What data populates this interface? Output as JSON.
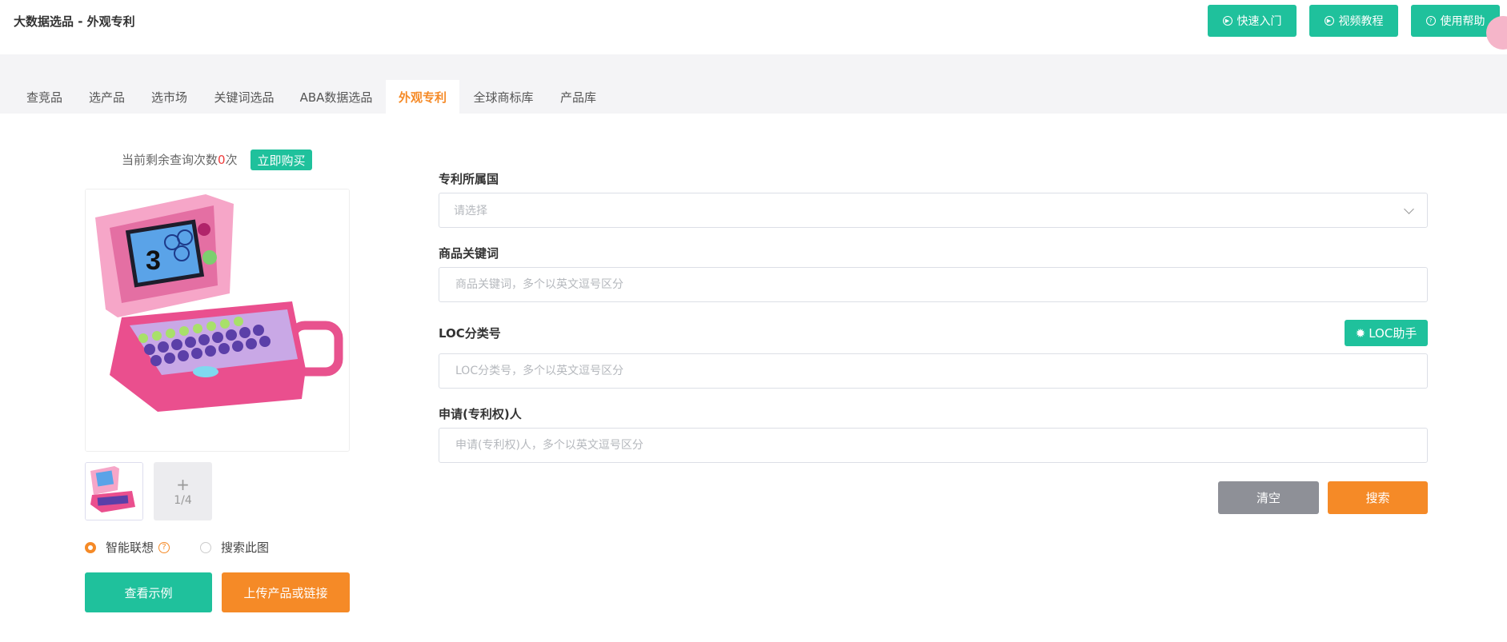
{
  "app": {
    "title": "大数据选品 - 外观专利"
  },
  "toolbar": {
    "quick_start": "快速入门",
    "video_tutorial": "视频教程",
    "help": "使用帮助"
  },
  "tabs": [
    {
      "label": "查竞品"
    },
    {
      "label": "选产品"
    },
    {
      "label": "选市场"
    },
    {
      "label": "关键词选品"
    },
    {
      "label": "ABA数据选品"
    },
    {
      "label": "外观专利",
      "active": true
    },
    {
      "label": "全球商标库"
    },
    {
      "label": "产品库"
    }
  ],
  "quota": {
    "prefix": "当前剩余查询次数",
    "count": "0",
    "suffix": "次",
    "buy_label": "立即购买"
  },
  "image_panel": {
    "counter": "1/4",
    "plus": "+",
    "radio_smart": "智能联想",
    "radio_this_image": "搜索此图",
    "help_mark": "?",
    "example_btn": "查看示例",
    "upload_btn": "上传产品或链接"
  },
  "form": {
    "country": {
      "label": "专利所属国",
      "placeholder": "请选择"
    },
    "keyword": {
      "label": "商品关键词",
      "placeholder": "商品关键词，多个以英文逗号区分"
    },
    "loc": {
      "label": "LOC分类号",
      "placeholder": "LOC分类号，多个以英文逗号区分",
      "helper_btn": "LOC助手"
    },
    "applicant": {
      "label": "申请(专利权)人",
      "placeholder": "申请(专利权)人，多个以英文逗号区分"
    },
    "clear_btn": "清空",
    "search_btn": "搜索"
  },
  "colors": {
    "accent_green": "#1fc19c",
    "accent_orange": "#f58a27",
    "quota_red": "#ee3b3b"
  }
}
